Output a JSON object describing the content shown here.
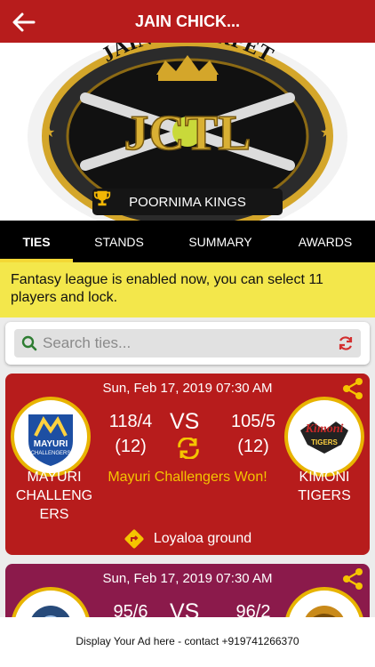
{
  "header": {
    "title": "JAIN CHICK...",
    "back_icon": "arrow-left-icon"
  },
  "banner": {
    "arc_text": "JAIN CHICKPET",
    "logo_letters": "JCTL",
    "team_label": "POORNIMA KINGS"
  },
  "tabs": [
    {
      "label": "TIES",
      "active": true
    },
    {
      "label": "STANDS",
      "active": false
    },
    {
      "label": "SUMMARY",
      "active": false
    },
    {
      "label": "AWARDS",
      "active": false
    }
  ],
  "notice": {
    "text": "Fantasy league is enabled now, you can select 11 players and lock."
  },
  "search": {
    "placeholder": "Search ties...",
    "value": ""
  },
  "matches": [
    {
      "date": "Sun, Feb 17, 2019 07:30 AM",
      "vs": "VS",
      "team1": {
        "name": "MAYURI CHALLENG ERS",
        "runs": "118/4",
        "overs": "(12)",
        "logo_text": "MAYURI",
        "logo_sub": "CHALLENGERS"
      },
      "team2": {
        "name": "KIMONI TIGERS",
        "runs": "105/5",
        "overs": "(12)",
        "logo_text": "Kimoni",
        "logo_sub": "TIGERS"
      },
      "result": "Mayuri Challengers Won!",
      "ground": "Loyaloa ground"
    },
    {
      "date": "Sun, Feb 17, 2019 07:30 AM",
      "vs": "VS",
      "team1": {
        "runs": "95/6"
      },
      "team2": {
        "runs": "96/2"
      }
    }
  ],
  "ad": {
    "text": "Display Your Ad here - contact +919741266370"
  },
  "colors": {
    "primary": "#b71c1c",
    "accent": "#f3d835",
    "card2": "#8b1a4b",
    "result": "#f5c400"
  }
}
